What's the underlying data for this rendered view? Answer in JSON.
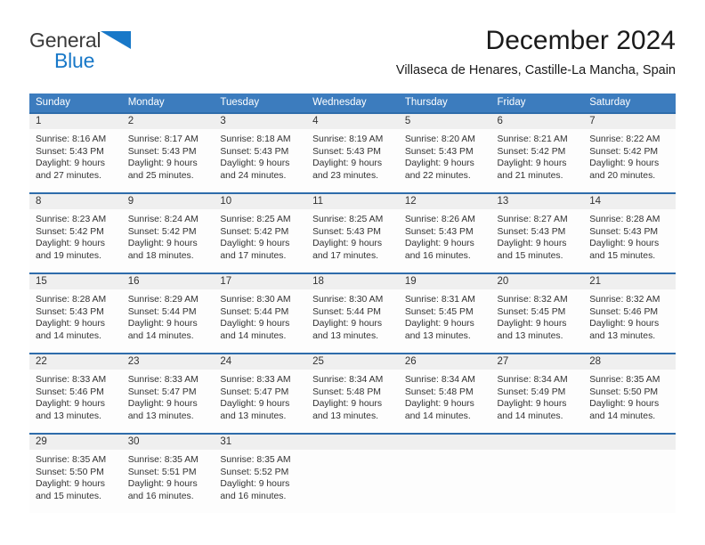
{
  "brand": {
    "name_part1": "General",
    "name_part2": "Blue",
    "triangle_color": "#1878c8",
    "text_color": "#3b3b3b"
  },
  "header": {
    "title": "December 2024",
    "subtitle": "Villaseca de Henares, Castille-La Mancha, Spain"
  },
  "colors": {
    "header_bg": "#3c7cbe",
    "week_divider": "#2e6cab",
    "daynum_bg": "#efefef",
    "accent_blue": "#1878c8"
  },
  "calendar": {
    "weekday_headers": [
      "Sunday",
      "Monday",
      "Tuesday",
      "Wednesday",
      "Thursday",
      "Friday",
      "Saturday"
    ],
    "weeks": [
      [
        {
          "day": "1",
          "sunrise": "Sunrise: 8:16 AM",
          "sunset": "Sunset: 5:43 PM",
          "daylight_line1": "Daylight: 9 hours",
          "daylight_line2": "and 27 minutes."
        },
        {
          "day": "2",
          "sunrise": "Sunrise: 8:17 AM",
          "sunset": "Sunset: 5:43 PM",
          "daylight_line1": "Daylight: 9 hours",
          "daylight_line2": "and 25 minutes."
        },
        {
          "day": "3",
          "sunrise": "Sunrise: 8:18 AM",
          "sunset": "Sunset: 5:43 PM",
          "daylight_line1": "Daylight: 9 hours",
          "daylight_line2": "and 24 minutes."
        },
        {
          "day": "4",
          "sunrise": "Sunrise: 8:19 AM",
          "sunset": "Sunset: 5:43 PM",
          "daylight_line1": "Daylight: 9 hours",
          "daylight_line2": "and 23 minutes."
        },
        {
          "day": "5",
          "sunrise": "Sunrise: 8:20 AM",
          "sunset": "Sunset: 5:43 PM",
          "daylight_line1": "Daylight: 9 hours",
          "daylight_line2": "and 22 minutes."
        },
        {
          "day": "6",
          "sunrise": "Sunrise: 8:21 AM",
          "sunset": "Sunset: 5:42 PM",
          "daylight_line1": "Daylight: 9 hours",
          "daylight_line2": "and 21 minutes."
        },
        {
          "day": "7",
          "sunrise": "Sunrise: 8:22 AM",
          "sunset": "Sunset: 5:42 PM",
          "daylight_line1": "Daylight: 9 hours",
          "daylight_line2": "and 20 minutes."
        }
      ],
      [
        {
          "day": "8",
          "sunrise": "Sunrise: 8:23 AM",
          "sunset": "Sunset: 5:42 PM",
          "daylight_line1": "Daylight: 9 hours",
          "daylight_line2": "and 19 minutes."
        },
        {
          "day": "9",
          "sunrise": "Sunrise: 8:24 AM",
          "sunset": "Sunset: 5:42 PM",
          "daylight_line1": "Daylight: 9 hours",
          "daylight_line2": "and 18 minutes."
        },
        {
          "day": "10",
          "sunrise": "Sunrise: 8:25 AM",
          "sunset": "Sunset: 5:42 PM",
          "daylight_line1": "Daylight: 9 hours",
          "daylight_line2": "and 17 minutes."
        },
        {
          "day": "11",
          "sunrise": "Sunrise: 8:25 AM",
          "sunset": "Sunset: 5:43 PM",
          "daylight_line1": "Daylight: 9 hours",
          "daylight_line2": "and 17 minutes."
        },
        {
          "day": "12",
          "sunrise": "Sunrise: 8:26 AM",
          "sunset": "Sunset: 5:43 PM",
          "daylight_line1": "Daylight: 9 hours",
          "daylight_line2": "and 16 minutes."
        },
        {
          "day": "13",
          "sunrise": "Sunrise: 8:27 AM",
          "sunset": "Sunset: 5:43 PM",
          "daylight_line1": "Daylight: 9 hours",
          "daylight_line2": "and 15 minutes."
        },
        {
          "day": "14",
          "sunrise": "Sunrise: 8:28 AM",
          "sunset": "Sunset: 5:43 PM",
          "daylight_line1": "Daylight: 9 hours",
          "daylight_line2": "and 15 minutes."
        }
      ],
      [
        {
          "day": "15",
          "sunrise": "Sunrise: 8:28 AM",
          "sunset": "Sunset: 5:43 PM",
          "daylight_line1": "Daylight: 9 hours",
          "daylight_line2": "and 14 minutes."
        },
        {
          "day": "16",
          "sunrise": "Sunrise: 8:29 AM",
          "sunset": "Sunset: 5:44 PM",
          "daylight_line1": "Daylight: 9 hours",
          "daylight_line2": "and 14 minutes."
        },
        {
          "day": "17",
          "sunrise": "Sunrise: 8:30 AM",
          "sunset": "Sunset: 5:44 PM",
          "daylight_line1": "Daylight: 9 hours",
          "daylight_line2": "and 14 minutes."
        },
        {
          "day": "18",
          "sunrise": "Sunrise: 8:30 AM",
          "sunset": "Sunset: 5:44 PM",
          "daylight_line1": "Daylight: 9 hours",
          "daylight_line2": "and 13 minutes."
        },
        {
          "day": "19",
          "sunrise": "Sunrise: 8:31 AM",
          "sunset": "Sunset: 5:45 PM",
          "daylight_line1": "Daylight: 9 hours",
          "daylight_line2": "and 13 minutes."
        },
        {
          "day": "20",
          "sunrise": "Sunrise: 8:32 AM",
          "sunset": "Sunset: 5:45 PM",
          "daylight_line1": "Daylight: 9 hours",
          "daylight_line2": "and 13 minutes."
        },
        {
          "day": "21",
          "sunrise": "Sunrise: 8:32 AM",
          "sunset": "Sunset: 5:46 PM",
          "daylight_line1": "Daylight: 9 hours",
          "daylight_line2": "and 13 minutes."
        }
      ],
      [
        {
          "day": "22",
          "sunrise": "Sunrise: 8:33 AM",
          "sunset": "Sunset: 5:46 PM",
          "daylight_line1": "Daylight: 9 hours",
          "daylight_line2": "and 13 minutes."
        },
        {
          "day": "23",
          "sunrise": "Sunrise: 8:33 AM",
          "sunset": "Sunset: 5:47 PM",
          "daylight_line1": "Daylight: 9 hours",
          "daylight_line2": "and 13 minutes."
        },
        {
          "day": "24",
          "sunrise": "Sunrise: 8:33 AM",
          "sunset": "Sunset: 5:47 PM",
          "daylight_line1": "Daylight: 9 hours",
          "daylight_line2": "and 13 minutes."
        },
        {
          "day": "25",
          "sunrise": "Sunrise: 8:34 AM",
          "sunset": "Sunset: 5:48 PM",
          "daylight_line1": "Daylight: 9 hours",
          "daylight_line2": "and 13 minutes."
        },
        {
          "day": "26",
          "sunrise": "Sunrise: 8:34 AM",
          "sunset": "Sunset: 5:48 PM",
          "daylight_line1": "Daylight: 9 hours",
          "daylight_line2": "and 14 minutes."
        },
        {
          "day": "27",
          "sunrise": "Sunrise: 8:34 AM",
          "sunset": "Sunset: 5:49 PM",
          "daylight_line1": "Daylight: 9 hours",
          "daylight_line2": "and 14 minutes."
        },
        {
          "day": "28",
          "sunrise": "Sunrise: 8:35 AM",
          "sunset": "Sunset: 5:50 PM",
          "daylight_line1": "Daylight: 9 hours",
          "daylight_line2": "and 14 minutes."
        }
      ],
      [
        {
          "day": "29",
          "sunrise": "Sunrise: 8:35 AM",
          "sunset": "Sunset: 5:50 PM",
          "daylight_line1": "Daylight: 9 hours",
          "daylight_line2": "and 15 minutes."
        },
        {
          "day": "30",
          "sunrise": "Sunrise: 8:35 AM",
          "sunset": "Sunset: 5:51 PM",
          "daylight_line1": "Daylight: 9 hours",
          "daylight_line2": "and 16 minutes."
        },
        {
          "day": "31",
          "sunrise": "Sunrise: 8:35 AM",
          "sunset": "Sunset: 5:52 PM",
          "daylight_line1": "Daylight: 9 hours",
          "daylight_line2": "and 16 minutes."
        },
        {
          "day": "",
          "sunrise": "",
          "sunset": "",
          "daylight_line1": "",
          "daylight_line2": ""
        },
        {
          "day": "",
          "sunrise": "",
          "sunset": "",
          "daylight_line1": "",
          "daylight_line2": ""
        },
        {
          "day": "",
          "sunrise": "",
          "sunset": "",
          "daylight_line1": "",
          "daylight_line2": ""
        },
        {
          "day": "",
          "sunrise": "",
          "sunset": "",
          "daylight_line1": "",
          "daylight_line2": ""
        }
      ]
    ]
  }
}
